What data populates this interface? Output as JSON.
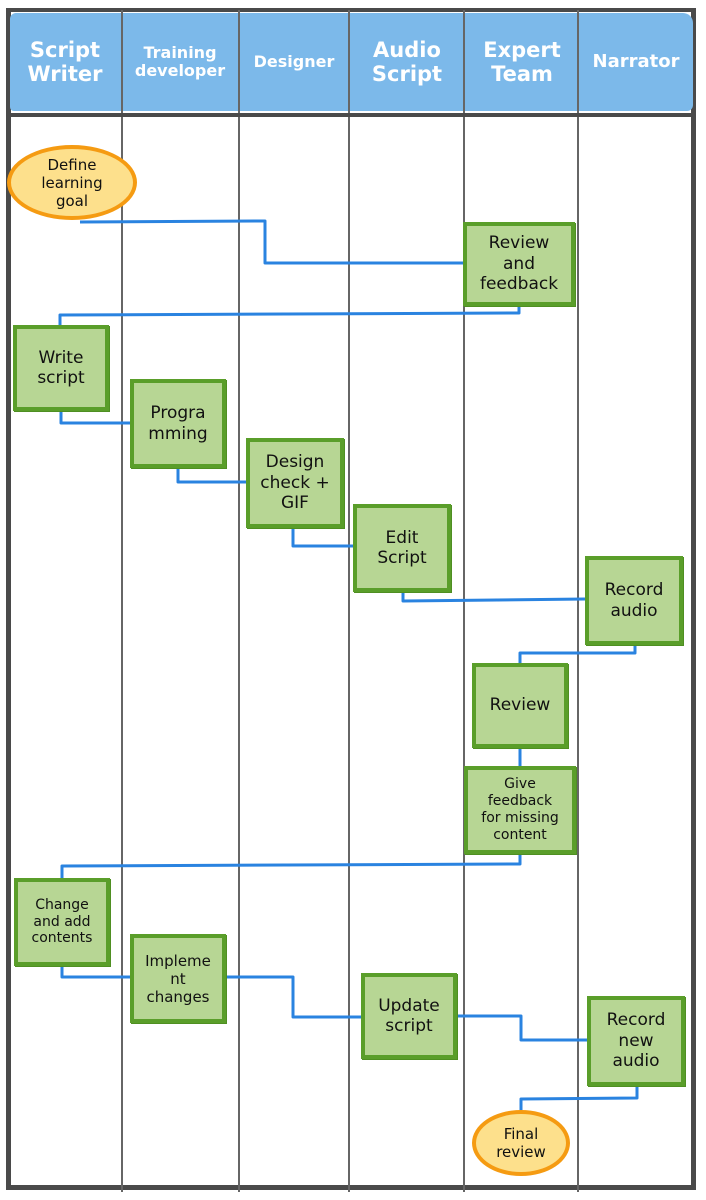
{
  "diagram": {
    "type": "swimlane-flowchart",
    "colors": {
      "header_fill": "#7cb9ea",
      "header_text": "#ffffff",
      "task_fill": "#b7d694",
      "task_border": "#5a9e2a",
      "terminal_fill": "#fde08c",
      "terminal_border": "#f59b12",
      "connector": "#2a83e0",
      "grid": "#4a4a4a"
    },
    "lanes": [
      {
        "id": "script-writer",
        "label": "Script\nWriter"
      },
      {
        "id": "training-developer",
        "label": "Training\ndeveloper"
      },
      {
        "id": "designer",
        "label": "Designer"
      },
      {
        "id": "audio-script",
        "label": "Audio\nScript"
      },
      {
        "id": "expert-team",
        "label": "Expert\nTeam"
      },
      {
        "id": "narrator",
        "label": "Narrator"
      }
    ],
    "nodes": [
      {
        "id": "n1",
        "lane": "script-writer",
        "shape": "terminal",
        "label": "Define\nlearning\ngoal"
      },
      {
        "id": "n2",
        "lane": "expert-team",
        "shape": "task",
        "label": "Review\nand\nfeedback"
      },
      {
        "id": "n3",
        "lane": "script-writer",
        "shape": "task",
        "label": "Write\nscript"
      },
      {
        "id": "n4",
        "lane": "training-developer",
        "shape": "task",
        "label": "Progra\nmming"
      },
      {
        "id": "n5",
        "lane": "designer",
        "shape": "task",
        "label": "Design\ncheck +\nGIF"
      },
      {
        "id": "n6",
        "lane": "audio-script",
        "shape": "task",
        "label": "Edit\nScript"
      },
      {
        "id": "n7",
        "lane": "narrator",
        "shape": "task",
        "label": "Record\naudio"
      },
      {
        "id": "n8",
        "lane": "expert-team",
        "shape": "task",
        "label": "Review"
      },
      {
        "id": "n9",
        "lane": "expert-team",
        "shape": "task",
        "label": "Give\nfeedback\nfor missing\ncontent"
      },
      {
        "id": "n10",
        "lane": "script-writer",
        "shape": "task",
        "label": "Change\nand add\ncontents"
      },
      {
        "id": "n11",
        "lane": "training-developer",
        "shape": "task",
        "label": "Impleme\nnt\nchanges"
      },
      {
        "id": "n12",
        "lane": "audio-script",
        "shape": "task",
        "label": "Update\nscript"
      },
      {
        "id": "n13",
        "lane": "narrator",
        "shape": "task",
        "label": "Record\nnew\naudio"
      },
      {
        "id": "n14",
        "lane": "expert-team",
        "shape": "terminal",
        "label": "Final\nreview"
      }
    ],
    "edges": [
      {
        "from": "n1",
        "to": "n2"
      },
      {
        "from": "n2",
        "to": "n3"
      },
      {
        "from": "n3",
        "to": "n4"
      },
      {
        "from": "n4",
        "to": "n5"
      },
      {
        "from": "n5",
        "to": "n6"
      },
      {
        "from": "n6",
        "to": "n7"
      },
      {
        "from": "n7",
        "to": "n8"
      },
      {
        "from": "n8",
        "to": "n9"
      },
      {
        "from": "n9",
        "to": "n10"
      },
      {
        "from": "n10",
        "to": "n11"
      },
      {
        "from": "n11",
        "to": "n12"
      },
      {
        "from": "n12",
        "to": "n13"
      },
      {
        "from": "n13",
        "to": "n14"
      }
    ]
  }
}
